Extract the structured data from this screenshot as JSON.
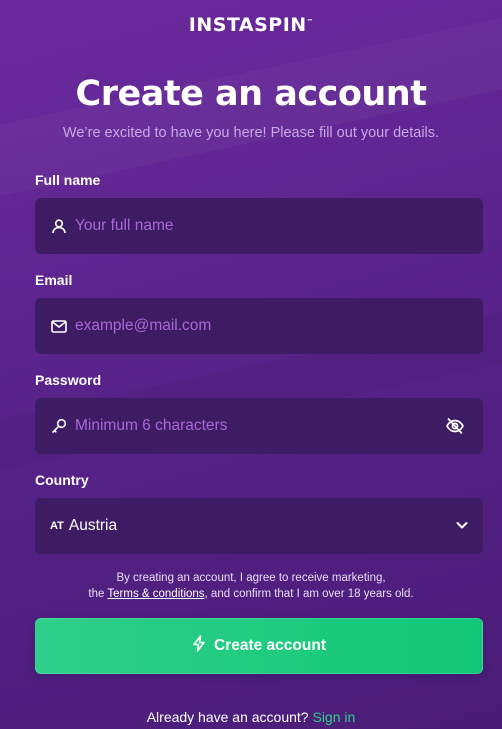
{
  "brand": {
    "logo_text": "INSTASPIN",
    "logo_mark": "™"
  },
  "header": {
    "title": "Create an account",
    "subtitle": "We’re excited to have you here! Please fill out your details."
  },
  "form": {
    "full_name": {
      "label": "Full name",
      "placeholder": "Your full name",
      "icon": "user-icon"
    },
    "email": {
      "label": "Email",
      "placeholder": "example@mail.com",
      "icon": "mail-icon"
    },
    "password": {
      "label": "Password",
      "placeholder": "Minimum 6 characters",
      "icon": "key-icon",
      "toggle_icon": "eye-off-icon"
    },
    "country": {
      "label": "Country",
      "flag": "AT",
      "value": "Austria",
      "icon": "chevron-down-icon"
    }
  },
  "consent": {
    "text_before": "By creating an account, I agree to receive marketing,",
    "text_the": "the ",
    "terms_link": "Terms & conditions",
    "text_after": ", and confirm that I am over 18 years old."
  },
  "cta": {
    "label": "Create account",
    "icon": "lightning-icon"
  },
  "footer": {
    "prompt": "Already have an account?",
    "link": "Sign in"
  },
  "colors": {
    "accent_green": "#2ecf8a",
    "field_bg": "#3e1c63",
    "placeholder": "#a868d8",
    "bg": "#5e2591"
  }
}
